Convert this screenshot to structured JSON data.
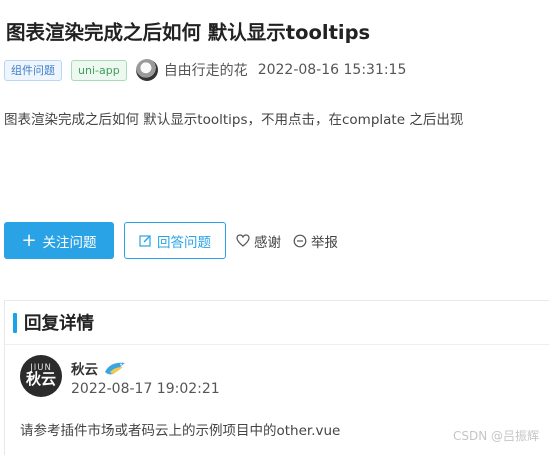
{
  "question": {
    "title": "图表渲染完成之后如何 默认显示tooltips",
    "tags": [
      "组件问题",
      "uni-app"
    ],
    "author": "自由行走的花",
    "time": "2022-08-16 15:31:15",
    "description": "图表渲染完成之后如何 默认显示tooltips，不用点击，在complate 之后出现"
  },
  "actions": {
    "follow_label": "关注问题",
    "answer_label": "回答问题",
    "thanks_label": "感谢",
    "report_label": "举报"
  },
  "reply_section": {
    "heading": "回复详情",
    "reply": {
      "avatar_top": "JIUN",
      "avatar_text": "秋云",
      "author": "秋云",
      "time": "2022-08-17 19:02:21",
      "content": "请参考插件市场或者码云上的示例项目中的other.vue"
    }
  },
  "watermark": "CSDN @吕振辉",
  "colors": {
    "primary": "#29a3e6",
    "accent_bar": "#1aa3e8",
    "tag_blue": "#3d7ec9",
    "tag_green": "#3f9e5a"
  },
  "icons": [
    "plus-icon",
    "edit-icon",
    "heart-icon",
    "report-icon",
    "bird-badge-icon"
  ]
}
